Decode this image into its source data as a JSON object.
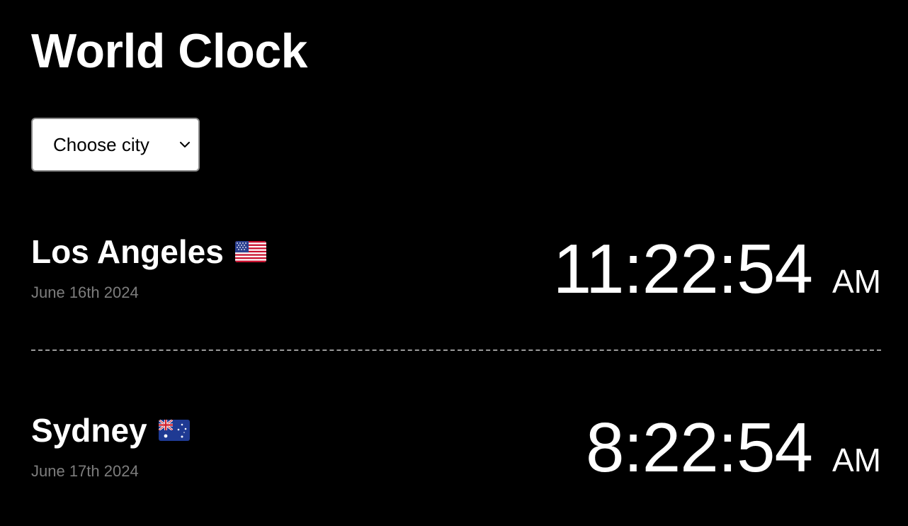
{
  "page": {
    "title": "World Clock"
  },
  "city_select": {
    "selected": "Choose city"
  },
  "cities": [
    {
      "name": "Los Angeles",
      "flag": "us-flag",
      "date": "June 16th 2024",
      "time": "11:22:54",
      "period": "AM"
    },
    {
      "name": "Sydney",
      "flag": "au-flag",
      "date": "June 17th 2024",
      "time": "8:22:54",
      "period": "AM"
    }
  ],
  "colors": {
    "background": "#000000",
    "text": "#ffffff",
    "date_text": "#7d7d7d",
    "divider": "#9a9a9a"
  }
}
